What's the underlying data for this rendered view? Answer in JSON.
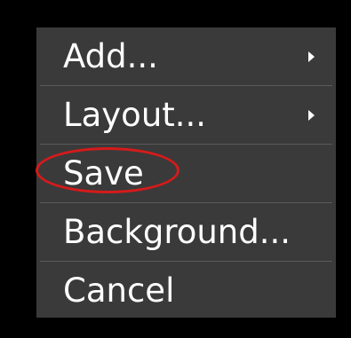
{
  "menu": {
    "items": [
      {
        "label": "Add...",
        "has_submenu": true,
        "submenu_icon": "chevron-right-icon"
      },
      {
        "label": "Layout...",
        "has_submenu": true,
        "submenu_icon": "chevron-right-icon"
      },
      {
        "label": "Save",
        "has_submenu": false,
        "highlighted": true
      },
      {
        "label": "Background...",
        "has_submenu": false
      },
      {
        "label": "Cancel",
        "has_submenu": false
      }
    ]
  },
  "colors": {
    "menu_background": "#3a3a3a",
    "screen_background": "#000000",
    "text": "#ffffff",
    "highlight_ring": "#d61a1a"
  }
}
